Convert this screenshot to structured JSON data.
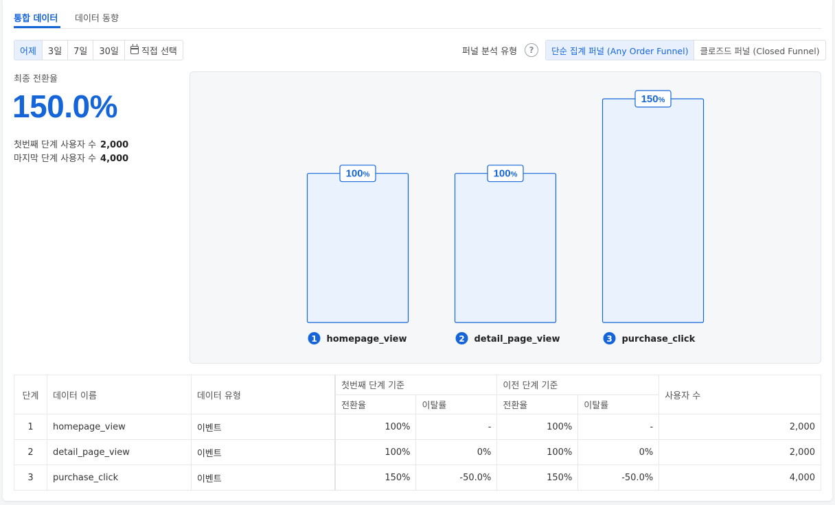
{
  "tabs": [
    {
      "label": "통합 데이터",
      "active": true
    },
    {
      "label": "데이터 동향",
      "active": false
    }
  ],
  "date_range": {
    "options": [
      "어제",
      "3일",
      "7일",
      "30일"
    ],
    "custom_label": "직접 선택",
    "selected": "어제"
  },
  "funnel_type": {
    "label": "퍼널 분석 유형",
    "help": "?",
    "options": [
      "단순 집계 퍼널 (Any Order Funnel)",
      "클로즈드 퍼널 (Closed Funnel)"
    ],
    "selected": "단순 집계 퍼널 (Any Order Funnel)"
  },
  "kpi": {
    "label": "최종 전환율",
    "value": "150.0%",
    "first_step_label": "첫번째 단계 사용자 수",
    "first_step_value": "2,000",
    "last_step_label": "마지막 단계 사용자 수",
    "last_step_value": "4,000"
  },
  "chart_data": {
    "type": "bar",
    "categories": [
      "homepage_view",
      "detail_page_view",
      "purchase_click"
    ],
    "step_numbers": [
      "1",
      "2",
      "3"
    ],
    "values": [
      100,
      100,
      150
    ],
    "data_labels": [
      "100",
      "100",
      "150"
    ],
    "label_unit": "%",
    "ylim": [
      0,
      150
    ],
    "colors": {
      "bar_fill": "#eaf2fd",
      "bar_stroke": "#1565d8",
      "badge": "#1565d8"
    }
  },
  "table": {
    "headers": {
      "step": "단계",
      "name": "데이터 이름",
      "type": "데이터 유형",
      "first_group": "첫번째 단계 기준",
      "prev_group": "이전 단계 기준",
      "conversion": "전환율",
      "dropoff": "이탈률",
      "users": "사용자 수"
    },
    "rows": [
      {
        "step": "1",
        "name": "homepage_view",
        "type": "이벤트",
        "first_conv": "100%",
        "first_drop": "-",
        "prev_conv": "100%",
        "prev_drop": "-",
        "users": "2,000"
      },
      {
        "step": "2",
        "name": "detail_page_view",
        "type": "이벤트",
        "first_conv": "100%",
        "first_drop": "0%",
        "prev_conv": "100%",
        "prev_drop": "0%",
        "users": "2,000"
      },
      {
        "step": "3",
        "name": "purchase_click",
        "type": "이벤트",
        "first_conv": "150%",
        "first_drop": "-50.0%",
        "prev_conv": "150%",
        "prev_drop": "-50.0%",
        "users": "4,000"
      }
    ]
  },
  "colors": {
    "accent": "#1565d8",
    "active_bg": "#e8f0fd"
  }
}
